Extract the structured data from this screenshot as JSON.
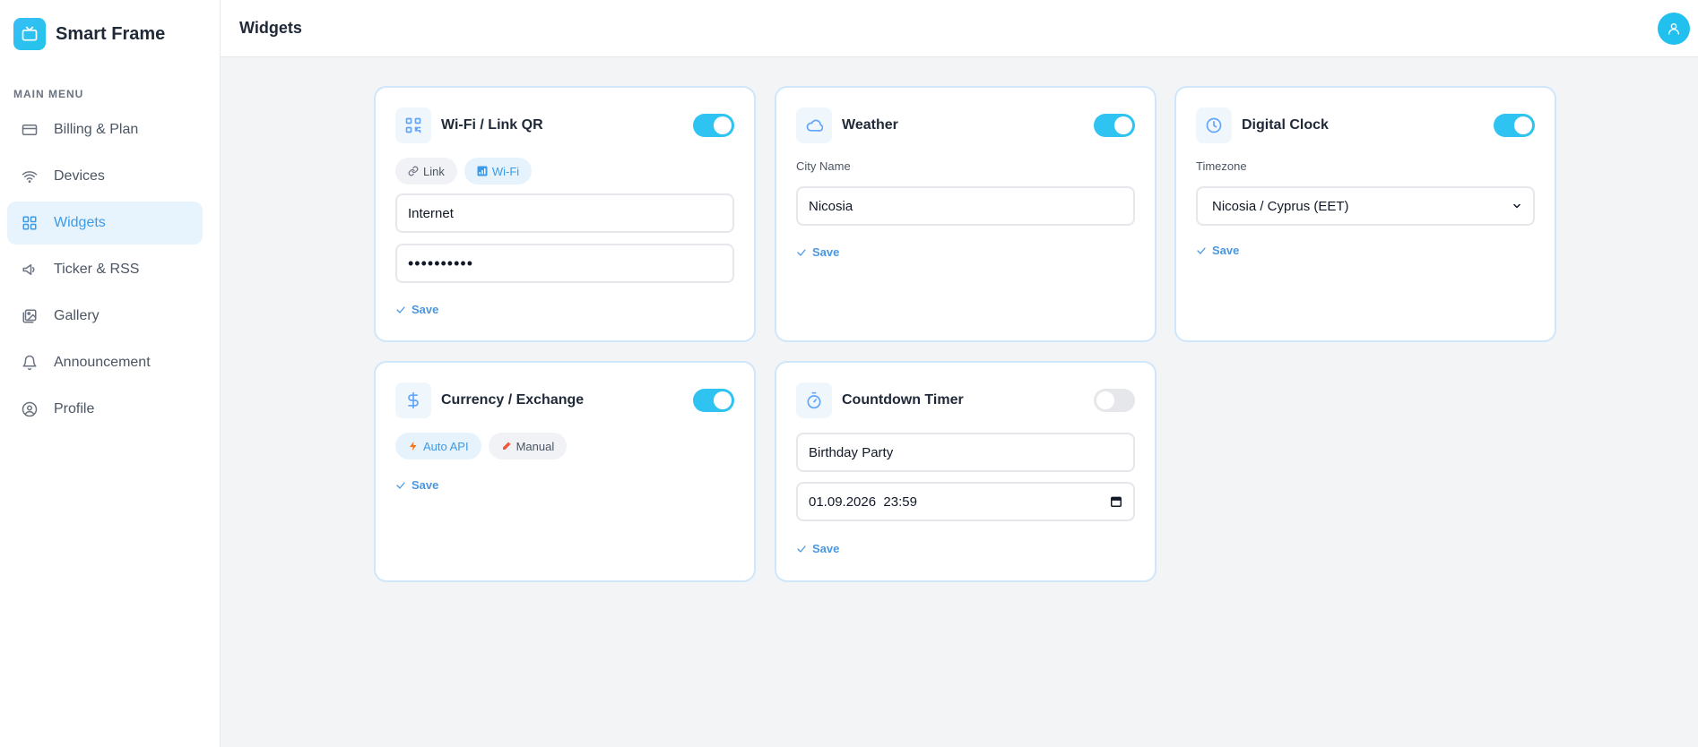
{
  "app": {
    "name": "Smart Frame"
  },
  "sidebar": {
    "heading": "MAIN MENU",
    "items": [
      {
        "label": "Billing & Plan",
        "icon": "credit-card-icon"
      },
      {
        "label": "Devices",
        "icon": "wifi-icon"
      },
      {
        "label": "Widgets",
        "icon": "grid-icon",
        "active": true
      },
      {
        "label": "Ticker & RSS",
        "icon": "megaphone-icon"
      },
      {
        "label": "Gallery",
        "icon": "gallery-icon"
      },
      {
        "label": "Announcement",
        "icon": "bell-icon"
      },
      {
        "label": "Profile",
        "icon": "user-circle-icon"
      }
    ]
  },
  "header": {
    "title": "Widgets",
    "avatar_icon": "user-icon"
  },
  "colors": {
    "accent": "#2ec3f0",
    "active_bg": "#e8f4fd",
    "active_text": "#3b9be8",
    "card_border": "#cfe6fb"
  },
  "widgets": {
    "wifi": {
      "title": "Wi-Fi / Link QR",
      "enabled": true,
      "modes": [
        "Link",
        "Wi-Fi"
      ],
      "active_mode": "Wi-Fi",
      "ssid": "Internet",
      "password_masked": "••••••••••",
      "save_label": "Save"
    },
    "weather": {
      "title": "Weather",
      "enabled": true,
      "city_label": "City Name",
      "city_value": "Nicosia",
      "save_label": "Save"
    },
    "clock": {
      "title": "Digital Clock",
      "enabled": true,
      "timezone_label": "Timezone",
      "timezone_value": "Nicosia / Cyprus (EET)",
      "save_label": "Save"
    },
    "currency": {
      "title": "Currency / Exchange",
      "enabled": true,
      "modes": [
        "Auto API",
        "Manual"
      ],
      "active_mode": "Auto API",
      "save_label": "Save"
    },
    "countdown": {
      "title": "Countdown Timer",
      "enabled": false,
      "event_name": "Birthday Party",
      "datetime": "01.09.2026  23:59",
      "save_label": "Save"
    }
  }
}
